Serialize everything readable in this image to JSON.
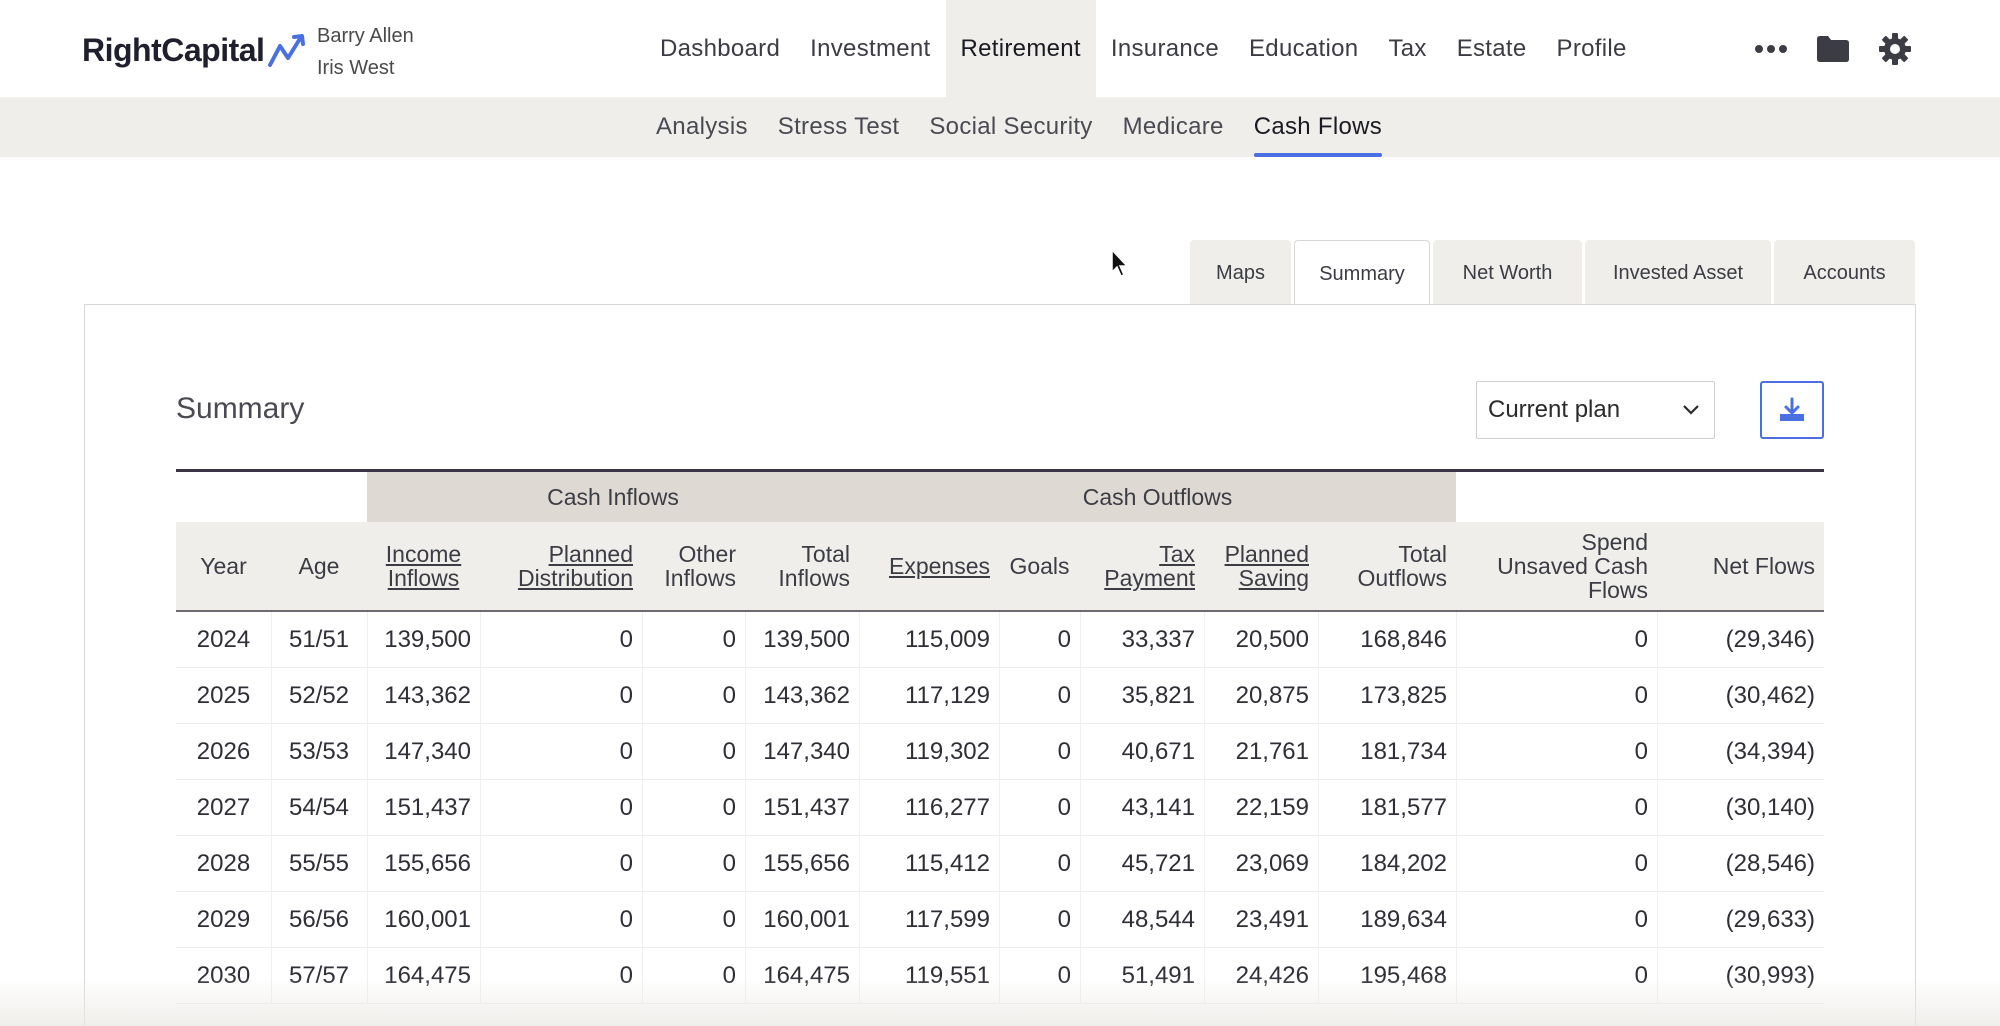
{
  "brand": {
    "name": "RightCapital"
  },
  "client": {
    "primary": "Barry Allen",
    "secondary": "Iris West"
  },
  "main_nav": [
    {
      "label": "Dashboard",
      "active": false
    },
    {
      "label": "Investment",
      "active": false
    },
    {
      "label": "Retirement",
      "active": true
    },
    {
      "label": "Insurance",
      "active": false
    },
    {
      "label": "Education",
      "active": false
    },
    {
      "label": "Tax",
      "active": false
    },
    {
      "label": "Estate",
      "active": false
    },
    {
      "label": "Profile",
      "active": false
    }
  ],
  "nav_icons": [
    "more-icon",
    "folder-icon",
    "gear-icon"
  ],
  "sub_nav": [
    {
      "label": "Analysis",
      "active": false
    },
    {
      "label": "Stress Test",
      "active": false
    },
    {
      "label": "Social Security",
      "active": false
    },
    {
      "label": "Medicare",
      "active": false
    },
    {
      "label": "Cash Flows",
      "active": true
    }
  ],
  "view_tabs": [
    {
      "label": "Maps",
      "active": false
    },
    {
      "label": "Summary",
      "active": true
    },
    {
      "label": "Net Worth",
      "active": false
    },
    {
      "label": "Invested Asset",
      "active": false
    },
    {
      "label": "Accounts",
      "active": false
    }
  ],
  "summary": {
    "title": "Summary",
    "plan_select_value": "Current plan",
    "download_icon": "download-icon"
  },
  "table": {
    "groups": {
      "inflows": "Cash Inflows",
      "outflows": "Cash Outflows"
    },
    "headers": {
      "year": "Year",
      "age": "Age",
      "income_1": "Income",
      "income_2": "Inflows",
      "planned_dist_1": "Planned",
      "planned_dist_2": "Distribution",
      "other_1": "Other",
      "other_2": "Inflows",
      "total_in_1": "Total",
      "total_in_2": "Inflows",
      "expenses": "Expenses",
      "goals": "Goals",
      "tax_1": "Tax",
      "tax_2": "Payment",
      "saving_1": "Planned",
      "saving_2": "Saving",
      "total_out_1": "Total",
      "total_out_2": "Outflows",
      "spend_1": "Spend",
      "spend_2": "Unsaved Cash",
      "spend_3": "Flows",
      "net": "Net Flows"
    },
    "rows": [
      [
        "2024",
        "51/51",
        "139,500",
        "0",
        "0",
        "139,500",
        "115,009",
        "0",
        "33,337",
        "20,500",
        "168,846",
        "0",
        "(29,346)"
      ],
      [
        "2025",
        "52/52",
        "143,362",
        "0",
        "0",
        "143,362",
        "117,129",
        "0",
        "35,821",
        "20,875",
        "173,825",
        "0",
        "(30,462)"
      ],
      [
        "2026",
        "53/53",
        "147,340",
        "0",
        "0",
        "147,340",
        "119,302",
        "0",
        "40,671",
        "21,761",
        "181,734",
        "0",
        "(34,394)"
      ],
      [
        "2027",
        "54/54",
        "151,437",
        "0",
        "0",
        "151,437",
        "116,277",
        "0",
        "43,141",
        "22,159",
        "181,577",
        "0",
        "(30,140)"
      ],
      [
        "2028",
        "55/55",
        "155,656",
        "0",
        "0",
        "155,656",
        "115,412",
        "0",
        "45,721",
        "23,069",
        "184,202",
        "0",
        "(28,546)"
      ],
      [
        "2029",
        "56/56",
        "160,001",
        "0",
        "0",
        "160,001",
        "117,599",
        "0",
        "48,544",
        "23,491",
        "189,634",
        "0",
        "(29,633)"
      ],
      [
        "2030",
        "57/57",
        "164,475",
        "0",
        "0",
        "164,475",
        "119,551",
        "0",
        "51,491",
        "24,426",
        "195,468",
        "0",
        "(30,993)"
      ]
    ]
  },
  "colors": {
    "accent": "#4a6fe0",
    "nav_bg": "#efeeeb",
    "group_bg": "#dedad3"
  }
}
